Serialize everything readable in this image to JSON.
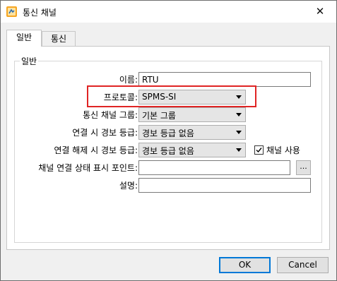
{
  "window": {
    "title": "통신 채널",
    "close_glyph": "✕"
  },
  "tabs": [
    {
      "label": "일반",
      "active": true
    },
    {
      "label": "통신",
      "active": false
    }
  ],
  "group": {
    "title": "일반"
  },
  "fields": {
    "name": {
      "label": "이름:",
      "value": "RTU"
    },
    "protocol": {
      "label": "프로토콜:",
      "value": "SPMS-SI"
    },
    "channel_group": {
      "label": "통신 채널 그룹:",
      "value": "기본 그룹"
    },
    "connect_alarm": {
      "label": "연결 시 경보 등급:",
      "value": "경보 등급 없음"
    },
    "disconnect_alarm": {
      "label": "연결 해제 시 경보 등급:",
      "value": "경보 등급 없음"
    },
    "channel_use": {
      "label": "채널 사용",
      "checked": true
    },
    "status_point": {
      "label": "채널 연결 상태 표시 포인트:",
      "value": "",
      "browse_label": "..."
    },
    "description": {
      "label": "설명:",
      "value": ""
    }
  },
  "buttons": {
    "ok": "OK",
    "cancel": "Cancel"
  },
  "colors": {
    "highlight": "#e02424",
    "default_button_border": "#0078d7"
  }
}
